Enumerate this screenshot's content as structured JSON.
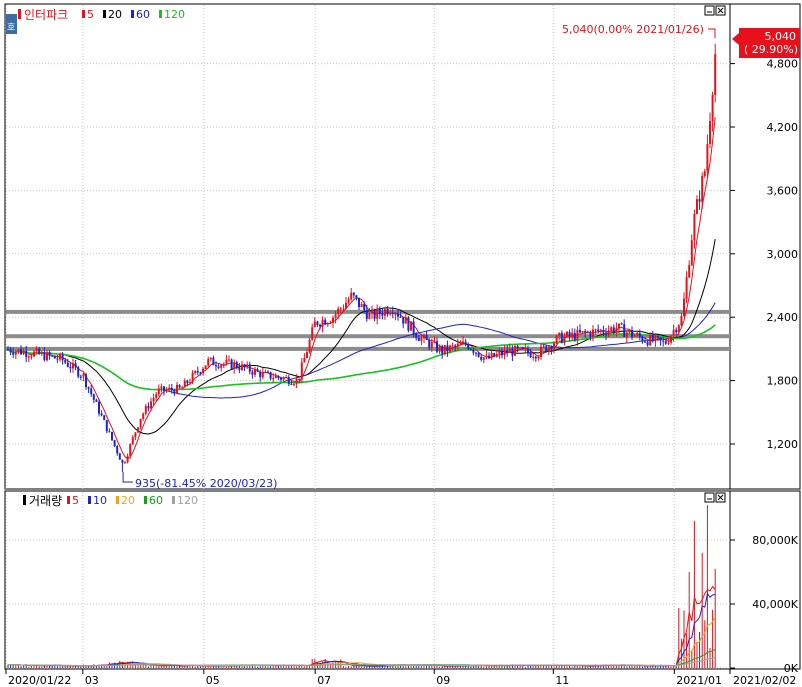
{
  "price_panel": {
    "title": "인터파크",
    "ma_legend": [
      {
        "label": "5",
        "color": "#e8101a"
      },
      {
        "label": "20",
        "color": "#000000"
      },
      {
        "label": "60",
        "color": "#1d23c8"
      },
      {
        "label": "120",
        "color": "#19c21d"
      }
    ],
    "corner_icon": "호",
    "window_buttons": [
      "minimize-icon",
      "close-icon"
    ],
    "high_annotation": "5,040(0.00% 2021/01/26)",
    "low_annotation": "935(-81.45% 2020/03/23)",
    "current_price_label": "5,040",
    "current_change_label": "( 29.90%)",
    "y_ticks": [
      "4,800",
      "4,200",
      "3,600",
      "3,000",
      "2,400",
      "1,800",
      "1,200"
    ],
    "colors": {
      "up": "#e8101a",
      "down": "#1d23c8",
      "support": "#8c8c8c"
    }
  },
  "volume_panel": {
    "title": "거래량",
    "ma_legend": [
      {
        "label": "5",
        "color": "#e8101a"
      },
      {
        "label": "10",
        "color": "#1d23c8"
      },
      {
        "label": "20",
        "color": "#f0a21a"
      },
      {
        "label": "60",
        "color": "#18a018"
      },
      {
        "label": "120",
        "color": "#a0a0a0"
      }
    ],
    "window_buttons": [
      "minimize-icon",
      "close-icon"
    ],
    "y_ticks": [
      "80,000K",
      "40,000K",
      "0K"
    ]
  },
  "x_axis": {
    "labels": [
      "2020/01/22",
      "03",
      "05",
      "07",
      "09",
      "11",
      "2021/01",
      "2021/02/02"
    ]
  },
  "chart_data": {
    "type": "candlestick",
    "price_ylim": [
      900,
      5100
    ],
    "price_ticks": [
      1200,
      1800,
      2400,
      3000,
      3600,
      4200,
      4800
    ],
    "volume_ylim": [
      0,
      110000
    ],
    "volume_ticks": [
      0,
      40000,
      80000
    ],
    "date_range": [
      "2020/01/22",
      "2021/02/02"
    ],
    "high": {
      "date": "2021/01/26",
      "value": 5040
    },
    "low": {
      "date": "2020/03/23",
      "value": 935
    },
    "last_close": 5040,
    "support_lines": [
      2450,
      2220,
      2100
    ],
    "price_path": [
      [
        "2020/01/22",
        2100
      ],
      [
        "2020/02/05",
        2060
      ],
      [
        "2020/02/20",
        2000
      ],
      [
        "2020/03/02",
        1850
      ],
      [
        "2020/03/12",
        1450
      ],
      [
        "2020/03/23",
        1000
      ],
      [
        "2020/04/01",
        1450
      ],
      [
        "2020/04/10",
        1700
      ],
      [
        "2020/04/22",
        1720
      ],
      [
        "2020/05/06",
        1980
      ],
      [
        "2020/05/20",
        1950
      ],
      [
        "2020/06/05",
        1850
      ],
      [
        "2020/06/22",
        1800
      ],
      [
        "2020/07/01",
        2350
      ],
      [
        "2020/07/10",
        2400
      ],
      [
        "2020/07/20",
        2600
      ],
      [
        "2020/07/30",
        2400
      ],
      [
        "2020/08/10",
        2500
      ],
      [
        "2020/08/25",
        2200
      ],
      [
        "2020/09/05",
        2080
      ],
      [
        "2020/09/18",
        2150
      ],
      [
        "2020/09/28",
        2000
      ],
      [
        "2020/10/10",
        2080
      ],
      [
        "2020/10/25",
        2060
      ],
      [
        "2020/11/05",
        2200
      ],
      [
        "2020/11/20",
        2250
      ],
      [
        "2020/12/05",
        2300
      ],
      [
        "2020/12/18",
        2200
      ],
      [
        "2020/12/30",
        2150
      ],
      [
        "2021/01/08",
        2400
      ],
      [
        "2021/01/14",
        3300
      ],
      [
        "2021/01/20",
        3800
      ],
      [
        "2021/01/26",
        5040
      ],
      [
        "2021/02/02",
        5040
      ]
    ],
    "volume_spikes": [
      [
        "2021/01/12",
        60000
      ],
      [
        "2021/01/14",
        92000
      ],
      [
        "2021/01/18",
        72000
      ],
      [
        "2021/01/21",
        104000
      ],
      [
        "2021/01/25",
        68000
      ],
      [
        "2021/01/26",
        62000
      ]
    ]
  }
}
